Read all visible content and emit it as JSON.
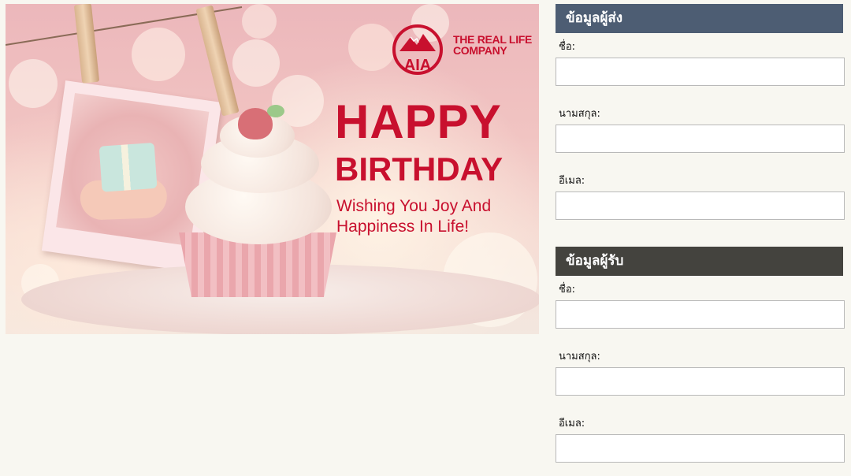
{
  "card": {
    "brand": "AIA",
    "tagline_line1": "THE REAL LIFE",
    "tagline_line2": "COMPANY",
    "headline": "HAPPY",
    "subheadline": "BIRTHDAY",
    "message_line1": "Wishing You Joy And",
    "message_line2": "Happiness In Life!",
    "brand_color": "#c8102e"
  },
  "sender": {
    "title": "ข้อมูลผู้ส่ง",
    "header_color": "#4d5d73",
    "first_name_label": "ชื่อ:",
    "first_name_value": "",
    "last_name_label": "นามสกุล:",
    "last_name_value": "",
    "email_label": "อีเมล:",
    "email_value": ""
  },
  "recipient": {
    "title": "ข้อมูลผู้รับ",
    "header_color": "#44433e",
    "first_name_label": "ชื่อ:",
    "first_name_value": "",
    "last_name_label": "นามสกุล:",
    "last_name_value": "",
    "email_label": "อีเมล:",
    "email_value": ""
  },
  "icons": {
    "logo": "aia-logo-icon"
  }
}
